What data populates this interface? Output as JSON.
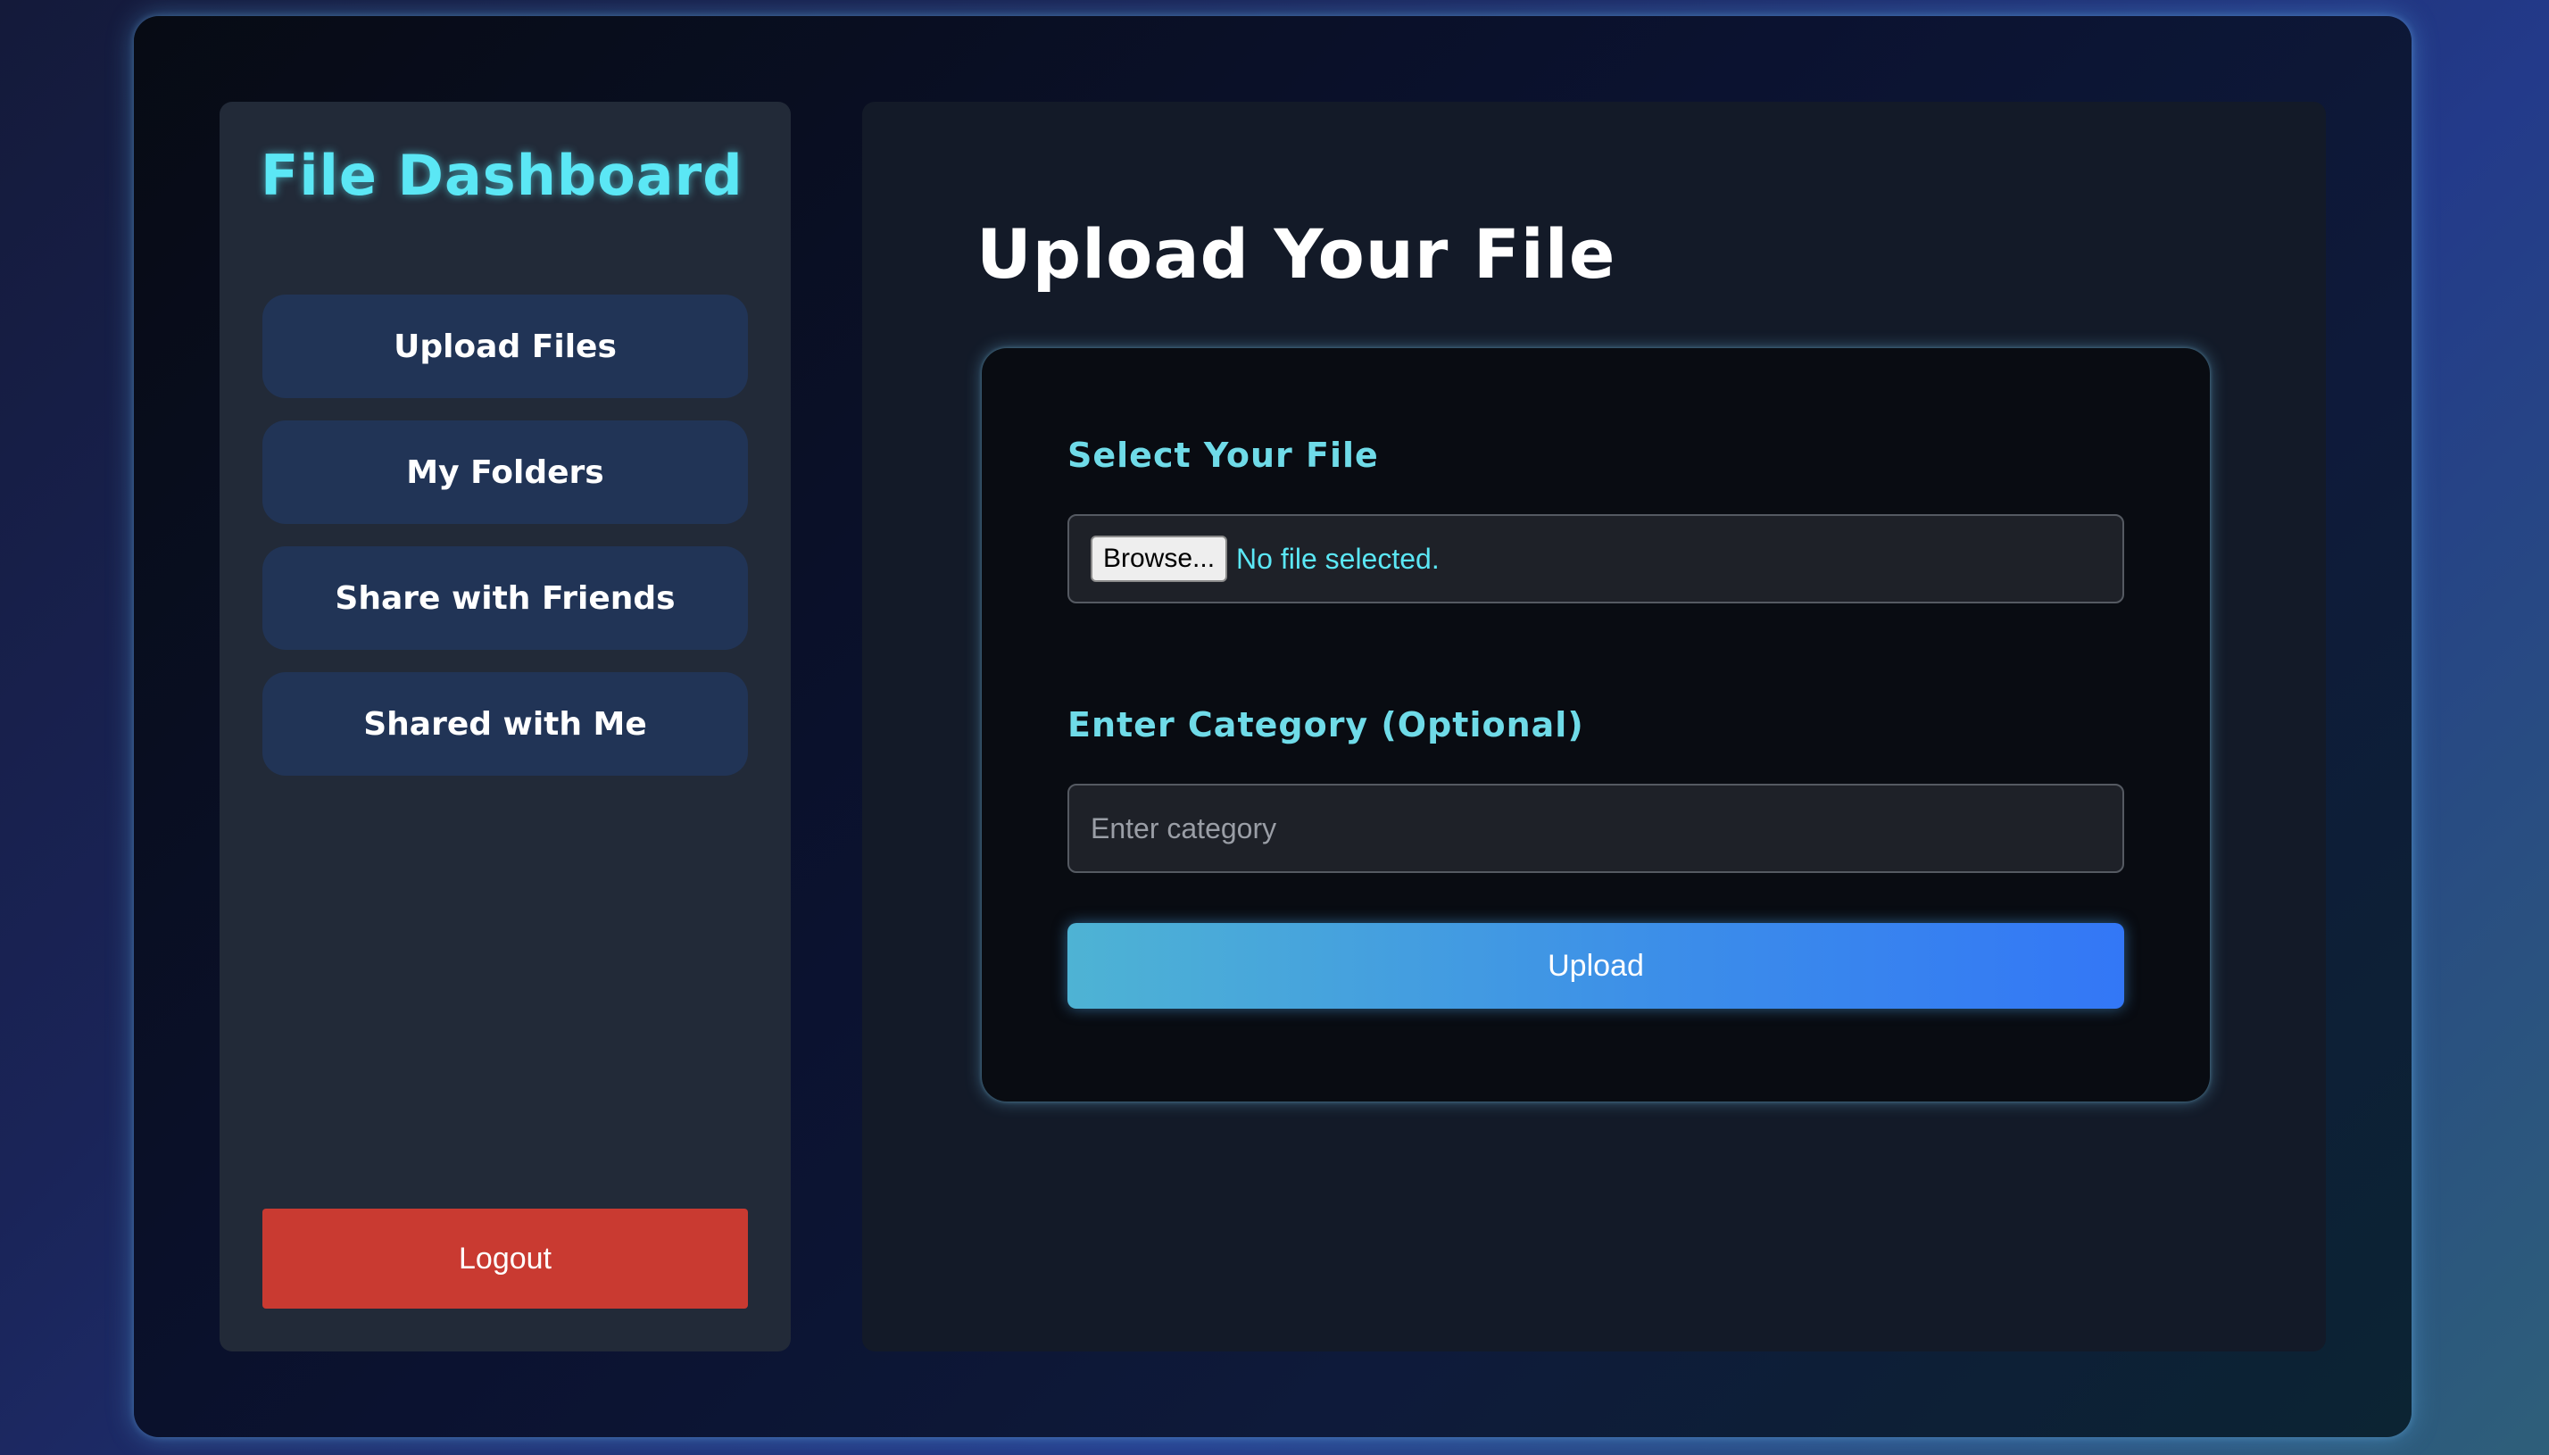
{
  "sidebar": {
    "title": "File Dashboard",
    "items": [
      {
        "label": "Upload Files"
      },
      {
        "label": "My Folders"
      },
      {
        "label": "Share with Friends"
      },
      {
        "label": "Shared with Me"
      }
    ],
    "logout_label": "Logout"
  },
  "main": {
    "title": "Upload Your File",
    "file_field": {
      "label": "Select Your File",
      "browse_label": "Browse...",
      "status": "No file selected."
    },
    "category_field": {
      "label": "Enter Category (Optional)",
      "placeholder": "Enter category",
      "value": ""
    },
    "upload_label": "Upload"
  },
  "colors": {
    "accent": "#5be7f5",
    "nav_button": "#213456",
    "logout": "#c93a31",
    "upload_gradient_start": "#4eb3d4",
    "upload_gradient_end": "#3377f6"
  }
}
